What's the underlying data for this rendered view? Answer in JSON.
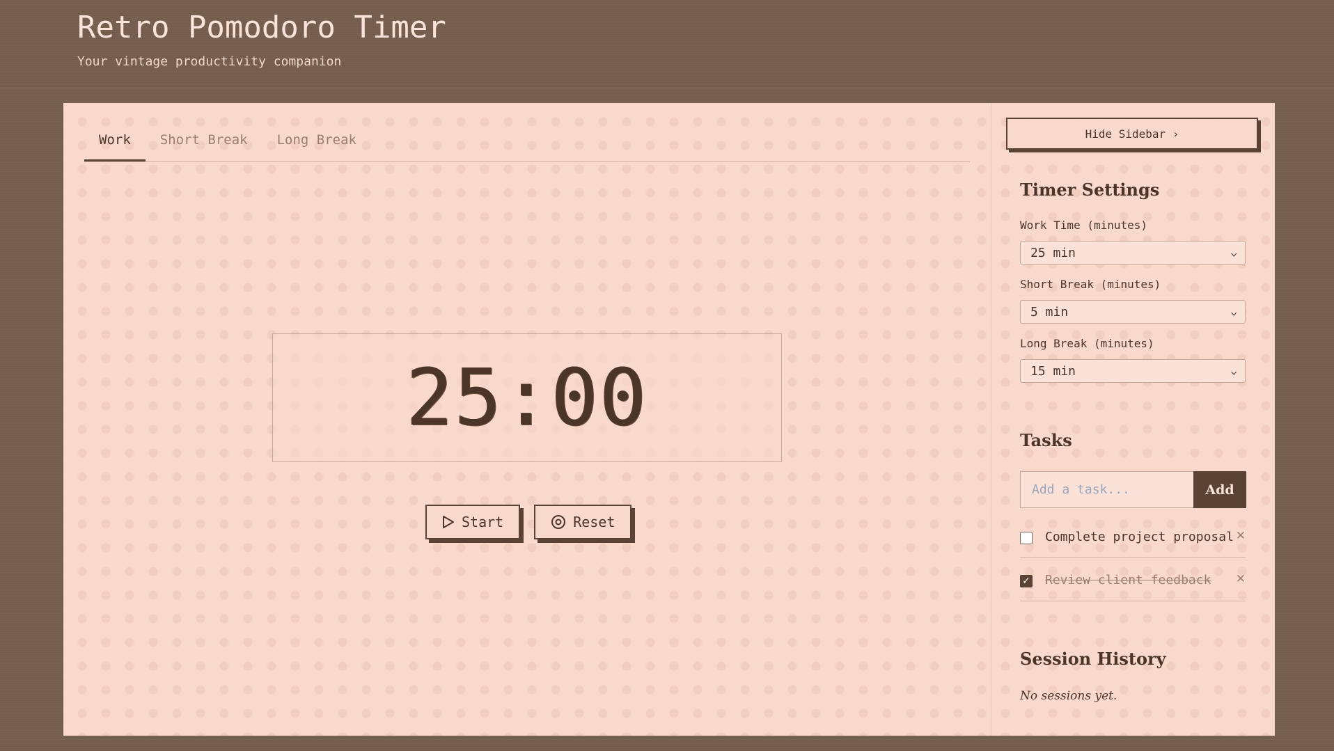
{
  "header": {
    "title": "Retro Pomodoro Timer",
    "subtitle": "Your vintage productivity companion"
  },
  "tabs": [
    {
      "label": "Work",
      "active": true
    },
    {
      "label": "Short Break",
      "active": false
    },
    {
      "label": "Long Break",
      "active": false
    }
  ],
  "timer": {
    "display": "25:00"
  },
  "controls": {
    "start_label": "Start",
    "start_icon": "play-icon",
    "reset_label": "Reset",
    "reset_icon": "reset-icon"
  },
  "sidebar": {
    "hide_label": "Hide Sidebar ›",
    "settings": {
      "title": "Timer Settings",
      "work_label": "Work Time (minutes)",
      "work_value": "25 min",
      "short_label": "Short Break (minutes)",
      "short_value": "5 min",
      "long_label": "Long Break (minutes)",
      "long_value": "15 min"
    },
    "tasks": {
      "title": "Tasks",
      "placeholder": "Add a task...",
      "add_label": "Add",
      "items": [
        {
          "text": "Complete project proposal",
          "done": false
        },
        {
          "text": "Review client feedback",
          "done": true
        }
      ]
    },
    "history": {
      "title": "Session History",
      "empty_text": "No sessions yet."
    }
  },
  "colors": {
    "background": "#76604f",
    "card": "#f9d9cc",
    "accent": "#5a4234",
    "text": "#4a3528"
  }
}
